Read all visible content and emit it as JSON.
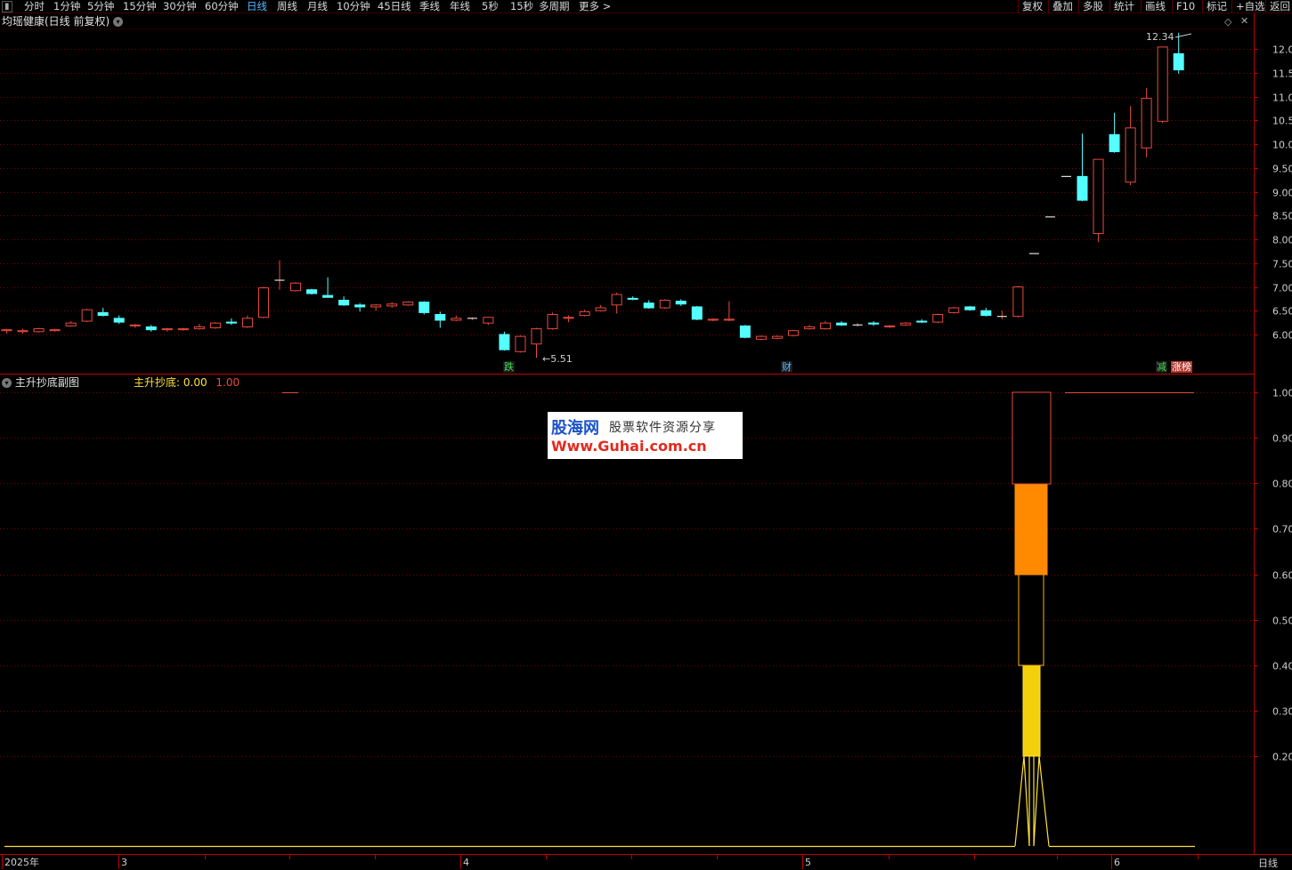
{
  "toolbar": {
    "items": [
      "分时",
      "1分钟",
      "5分钟",
      "15分钟",
      "30分钟",
      "60分钟",
      "日线",
      "周线",
      "月线",
      "10分钟",
      "45日线",
      "季线",
      "年线",
      "5秒",
      "15秒",
      "多周期",
      "更多 >"
    ],
    "active": "日线",
    "right_items": [
      "复权",
      "叠加",
      "多股",
      "统计",
      "画线",
      "F10",
      "标记",
      "+自选",
      "返回"
    ]
  },
  "main_chart": {
    "title": "均瑶健康(日线 前复权)",
    "y_ticks": [
      "12.00",
      "11.50",
      "11.00",
      "10.50",
      "10.00",
      "9.50",
      "9.00",
      "8.50",
      "8.00",
      "7.50",
      "7.00",
      "6.50",
      "6.00"
    ],
    "y_values": [
      12.0,
      11.5,
      11.0,
      10.5,
      10.0,
      9.5,
      9.0,
      8.5,
      8.0,
      7.5,
      7.0,
      6.5,
      6.0
    ],
    "high_label": "12.34",
    "low_label": "5.51",
    "tags": [
      {
        "text": "跌",
        "color": "#3fe04f",
        "bg": "#1a1a1a"
      },
      {
        "text": "财",
        "color": "#5cb8ff",
        "bg": "#1a1a1a"
      },
      {
        "text": "减",
        "color": "#3fe04f",
        "bg": "#1a1a1a"
      },
      {
        "text": "涨榜",
        "color": "#ffffff",
        "bg": "#b2362a"
      }
    ]
  },
  "sub_chart": {
    "title": "主升抄底副图",
    "indicator_name": "主升抄底:",
    "indicator_value": "0.00",
    "indicator_value2": "1.00",
    "y_ticks": [
      "1.00",
      "0.90",
      "0.80",
      "0.70",
      "0.60",
      "0.50",
      "0.40",
      "0.30",
      "0.20"
    ]
  },
  "x_axis": {
    "labels": [
      "2025年",
      "3",
      "4",
      "5",
      "6"
    ],
    "period_label": "日线"
  },
  "watermark": {
    "line1": "股海网",
    "line2": "股票软件资源分享",
    "line3": "Www.Guhai.com.cn"
  },
  "chart_data": {
    "type": "candlestick",
    "title": "均瑶健康(日线 前复权)",
    "ylim": [
      5.5,
      12.4
    ],
    "high": 12.34,
    "low": 5.51,
    "candles": [
      {
        "o": 6.08,
        "h": 6.12,
        "l": 6.02,
        "c": 6.1
      },
      {
        "o": 6.06,
        "h": 6.12,
        "l": 6.02,
        "c": 6.08
      },
      {
        "o": 6.06,
        "h": 6.14,
        "l": 6.04,
        "c": 6.12
      },
      {
        "o": 6.08,
        "h": 6.12,
        "l": 6.06,
        "c": 6.1
      },
      {
        "o": 6.18,
        "h": 6.28,
        "l": 6.16,
        "c": 6.24
      },
      {
        "o": 6.28,
        "h": 6.54,
        "l": 6.26,
        "c": 6.52
      },
      {
        "o": 6.46,
        "h": 6.56,
        "l": 6.38,
        "c": 6.4
      },
      {
        "o": 6.34,
        "h": 6.4,
        "l": 6.22,
        "c": 6.26
      },
      {
        "o": 6.18,
        "h": 6.22,
        "l": 6.14,
        "c": 6.2
      },
      {
        "o": 6.16,
        "h": 6.2,
        "l": 6.06,
        "c": 6.1
      },
      {
        "o": 6.1,
        "h": 6.14,
        "l": 6.06,
        "c": 6.12
      },
      {
        "o": 6.1,
        "h": 6.14,
        "l": 6.08,
        "c": 6.12
      },
      {
        "o": 6.12,
        "h": 6.22,
        "l": 6.1,
        "c": 6.16
      },
      {
        "o": 6.14,
        "h": 6.26,
        "l": 6.12,
        "c": 6.24
      },
      {
        "o": 6.26,
        "h": 6.34,
        "l": 6.2,
        "c": 6.24
      },
      {
        "o": 6.16,
        "h": 6.4,
        "l": 6.14,
        "c": 6.34
      },
      {
        "o": 6.36,
        "h": 7.0,
        "l": 6.34,
        "c": 6.98
      },
      {
        "o": 7.14,
        "h": 7.56,
        "l": 6.94,
        "c": 7.14
      },
      {
        "o": 6.92,
        "h": 7.1,
        "l": 6.9,
        "c": 7.08
      },
      {
        "o": 6.94,
        "h": 6.96,
        "l": 6.84,
        "c": 6.86
      },
      {
        "o": 6.82,
        "h": 7.2,
        "l": 6.78,
        "c": 6.78
      },
      {
        "o": 6.72,
        "h": 6.8,
        "l": 6.6,
        "c": 6.62
      },
      {
        "o": 6.62,
        "h": 6.66,
        "l": 6.48,
        "c": 6.58
      },
      {
        "o": 6.58,
        "h": 6.64,
        "l": 6.5,
        "c": 6.62
      },
      {
        "o": 6.6,
        "h": 6.68,
        "l": 6.56,
        "c": 6.64
      },
      {
        "o": 6.62,
        "h": 6.7,
        "l": 6.6,
        "c": 6.68
      },
      {
        "o": 6.68,
        "h": 6.7,
        "l": 6.42,
        "c": 6.46
      },
      {
        "o": 6.42,
        "h": 6.48,
        "l": 6.14,
        "c": 6.3
      },
      {
        "o": 6.3,
        "h": 6.4,
        "l": 6.28,
        "c": 6.34
      },
      {
        "o": 6.34,
        "h": 6.36,
        "l": 6.3,
        "c": 6.34
      },
      {
        "o": 6.24,
        "h": 6.36,
        "l": 6.2,
        "c": 6.36
      },
      {
        "o": 6.0,
        "h": 6.06,
        "l": 5.66,
        "c": 5.68
      },
      {
        "o": 5.64,
        "h": 5.98,
        "l": 5.62,
        "c": 5.96
      },
      {
        "o": 5.8,
        "h": 6.14,
        "l": 5.51,
        "c": 6.12
      },
      {
        "o": 6.12,
        "h": 6.46,
        "l": 6.1,
        "c": 6.42
      },
      {
        "o": 6.34,
        "h": 6.4,
        "l": 6.26,
        "c": 6.36
      },
      {
        "o": 6.4,
        "h": 6.52,
        "l": 6.38,
        "c": 6.48
      },
      {
        "o": 6.5,
        "h": 6.62,
        "l": 6.48,
        "c": 6.56
      },
      {
        "o": 6.62,
        "h": 6.88,
        "l": 6.44,
        "c": 6.84
      },
      {
        "o": 6.76,
        "h": 6.8,
        "l": 6.72,
        "c": 6.74
      },
      {
        "o": 6.66,
        "h": 6.72,
        "l": 6.54,
        "c": 6.56
      },
      {
        "o": 6.56,
        "h": 6.74,
        "l": 6.54,
        "c": 6.72
      },
      {
        "o": 6.7,
        "h": 6.74,
        "l": 6.6,
        "c": 6.64
      },
      {
        "o": 6.58,
        "h": 6.6,
        "l": 6.3,
        "c": 6.32
      },
      {
        "o": 6.3,
        "h": 6.34,
        "l": 6.28,
        "c": 6.32
      },
      {
        "o": 6.3,
        "h": 6.7,
        "l": 6.28,
        "c": 6.32
      },
      {
        "o": 6.18,
        "h": 6.2,
        "l": 5.92,
        "c": 5.94
      },
      {
        "o": 5.9,
        "h": 5.98,
        "l": 5.88,
        "c": 5.96
      },
      {
        "o": 5.92,
        "h": 5.98,
        "l": 5.9,
        "c": 5.96
      },
      {
        "o": 5.98,
        "h": 6.1,
        "l": 5.96,
        "c": 6.08
      },
      {
        "o": 6.12,
        "h": 6.2,
        "l": 6.1,
        "c": 6.16
      },
      {
        "o": 6.12,
        "h": 6.28,
        "l": 6.1,
        "c": 6.24
      },
      {
        "o": 6.24,
        "h": 6.28,
        "l": 6.18,
        "c": 6.2
      },
      {
        "o": 6.2,
        "h": 6.24,
        "l": 6.16,
        "c": 6.2
      },
      {
        "o": 6.24,
        "h": 6.28,
        "l": 6.18,
        "c": 6.22
      },
      {
        "o": 6.16,
        "h": 6.2,
        "l": 6.14,
        "c": 6.18
      },
      {
        "o": 6.2,
        "h": 6.26,
        "l": 6.18,
        "c": 6.24
      },
      {
        "o": 6.28,
        "h": 6.32,
        "l": 6.24,
        "c": 6.26
      },
      {
        "o": 6.26,
        "h": 6.44,
        "l": 6.24,
        "c": 6.42
      },
      {
        "o": 6.46,
        "h": 6.58,
        "l": 6.44,
        "c": 6.56
      },
      {
        "o": 6.58,
        "h": 6.6,
        "l": 6.5,
        "c": 6.52
      },
      {
        "o": 6.5,
        "h": 6.56,
        "l": 6.38,
        "c": 6.4
      },
      {
        "o": 6.38,
        "h": 6.5,
        "l": 6.32,
        "c": 6.38
      },
      {
        "o": 6.38,
        "h": 7.02,
        "l": 6.36,
        "c": 7.0
      },
      {
        "o": 7.7,
        "h": 7.7,
        "l": 7.7,
        "c": 7.7
      },
      {
        "o": 8.47,
        "h": 8.47,
        "l": 8.47,
        "c": 8.47
      },
      {
        "o": 9.32,
        "h": 9.32,
        "l": 9.32,
        "c": 9.32
      },
      {
        "o": 9.32,
        "h": 10.22,
        "l": 8.8,
        "c": 8.82
      },
      {
        "o": 8.12,
        "h": 9.68,
        "l": 7.94,
        "c": 9.68
      },
      {
        "o": 10.2,
        "h": 10.66,
        "l": 9.82,
        "c": 9.84
      },
      {
        "o": 9.2,
        "h": 10.8,
        "l": 9.14,
        "c": 10.34
      },
      {
        "o": 9.92,
        "h": 11.18,
        "l": 9.72,
        "c": 10.96
      },
      {
        "o": 10.48,
        "h": 12.04,
        "l": 10.44,
        "c": 12.04
      },
      {
        "o": 11.9,
        "h": 12.34,
        "l": 11.48,
        "c": 11.56
      }
    ]
  },
  "colors": {
    "up": "#e84a3d",
    "down": "#54ffff",
    "grid": "#7a0000",
    "axis_line": "#c00000",
    "indicator_yellow": "#ffe13c",
    "indicator_orange": "#ff8a00"
  }
}
